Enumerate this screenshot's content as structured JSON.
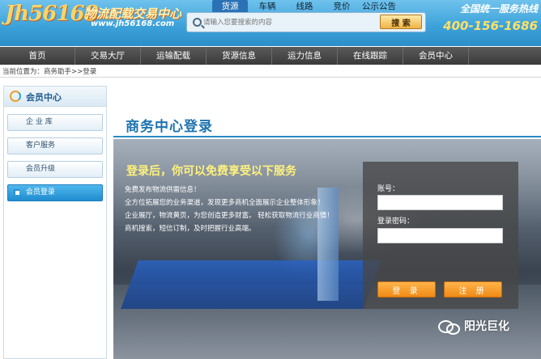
{
  "header": {
    "logo_mark": "Jh56168",
    "logo_cn": "物流配载交易中心",
    "logo_domain": "www.jh56168.com",
    "search_tabs": [
      {
        "label": "货源",
        "active": true
      },
      {
        "label": "车辆",
        "active": false
      },
      {
        "label": "线路",
        "active": false
      },
      {
        "label": "竞价",
        "active": false
      },
      {
        "label": "公示公告",
        "active": false
      }
    ],
    "search_placeholder": "请输入您要搜索的内容",
    "search_button": "搜 索",
    "hotline_title": "全国统一服务热线",
    "hotline_number": "400-156-1686"
  },
  "nav": {
    "items": [
      "首页",
      "交易大厅",
      "运输配载",
      "货源信息",
      "运力信息",
      "在线跟踪",
      "会员中心"
    ]
  },
  "breadcrumb": "当前位置为：商务助手>>登录",
  "sidebar": {
    "title": "会员中心",
    "items": [
      {
        "label": "企 业 库",
        "active": false
      },
      {
        "label": "客户服务",
        "active": false
      },
      {
        "label": "会员升级",
        "active": false
      },
      {
        "label": "会员登录",
        "active": true
      }
    ]
  },
  "main": {
    "title": "商务中心登录",
    "banner_heading": "登录后，你可以免费享受以下服务",
    "banner_lines": [
      "免费发布物流供需信息！",
      "全方位拓展您的业务渠道，发现更多商机全面展示企业整体形象！",
      "企业展厅，物流黄页，为您创造更多财富。 轻松获取物流行业商情！",
      "商机搜索，短信订制，及时把握行业高端。"
    ],
    "login": {
      "account_label": "账号：",
      "password_label": "登录密码：",
      "login_button": "登 录",
      "register_button": "注 册",
      "account_value": "",
      "password_value": ""
    }
  },
  "watermark": "阳光巨化"
}
